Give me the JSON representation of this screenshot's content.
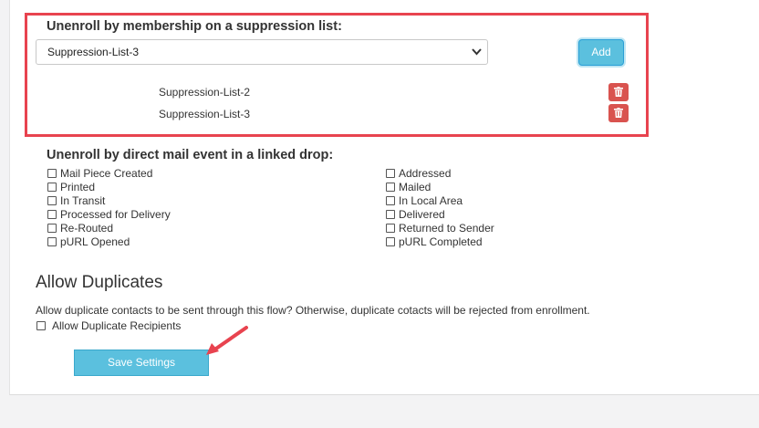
{
  "suppression": {
    "heading": "Unenroll by membership on a suppression list:",
    "selected": "Suppression-List-3",
    "add_label": "Add",
    "items": [
      {
        "label": "Suppression-List-2"
      },
      {
        "label": "Suppression-List-3"
      }
    ]
  },
  "direct_mail": {
    "heading": "Unenroll by direct mail event in a linked drop:",
    "left": [
      "Mail Piece Created",
      "Printed",
      "In Transit",
      "Processed for Delivery",
      "Re-Routed",
      "pURL Opened"
    ],
    "right": [
      "Addressed",
      "Mailed",
      "In Local Area",
      "Delivered",
      "Returned to Sender",
      "pURL Completed"
    ]
  },
  "duplicates": {
    "heading": "Allow Duplicates",
    "description": "Allow duplicate contacts to be sent through this flow? Otherwise, duplicate cotacts will be rejected from enrollment.",
    "checkbox_label": "Allow Duplicate Recipients"
  },
  "save_label": "Save Settings",
  "colors": {
    "accent": "#5bc0de",
    "danger": "#d9534f",
    "highlight": "#e8434f"
  }
}
